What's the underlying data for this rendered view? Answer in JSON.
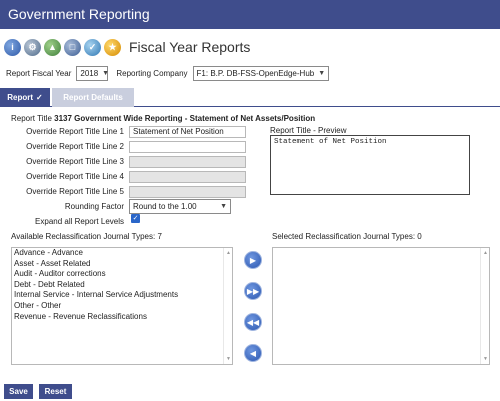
{
  "app": {
    "title": "Government Reporting"
  },
  "toolbar": {
    "icons": [
      "info-icon",
      "settings-gear-icon",
      "chart-icon",
      "documents-icon",
      "checklist-icon",
      "government-seal-icon"
    ],
    "page_title": "Fiscal Year Reports"
  },
  "filters": {
    "fiscal_year_label": "Report Fiscal Year",
    "fiscal_year_value": "2018",
    "company_label": "Reporting Company",
    "company_value": "F1: B.P. DB-FSS-OpenEdge-Hub"
  },
  "tabs": [
    {
      "label": "Report",
      "active": true
    },
    {
      "label": "Report Defaults",
      "active": false
    }
  ],
  "report": {
    "title_label": "Report Title",
    "title_value": "3137 Government Wide Reporting - Statement of Net Assets/Position",
    "override_lines": [
      {
        "label": "Override Report Title Line 1",
        "value": "Statement of Net Position",
        "enabled": true
      },
      {
        "label": "Override Report Title Line 2",
        "value": "",
        "enabled": true
      },
      {
        "label": "Override Report Title Line 3",
        "value": "",
        "enabled": false
      },
      {
        "label": "Override Report Title Line 4",
        "value": "",
        "enabled": false
      },
      {
        "label": "Override Report Title Line 5",
        "value": "",
        "enabled": false
      }
    ],
    "preview_label": "Report Title - Preview",
    "preview_text": "Statement of Net Position",
    "rounding_label": "Rounding Factor",
    "rounding_value": "Round to the 1.00",
    "expand_label": "Expand all Report Levels",
    "expand_checked": true
  },
  "reclass": {
    "available_label": "Available Reclassification Journal Types: 7",
    "selected_label": "Selected Reclassification Journal Types: 0",
    "available_items": [
      "Advance - Advance",
      "Asset - Asset Related",
      "Audit - Auditor corrections",
      "Debt - Debt Related",
      "Internal Service - Internal Service Adjustments",
      "Other - Other",
      "Revenue - Revenue Reclassifications"
    ],
    "selected_items": []
  },
  "buttons": {
    "save": "Save",
    "reset": "Reset"
  },
  "colors": {
    "brand": "#3f4d8c",
    "tab_inactive": "#c9cede",
    "move_button": "#2b57b0"
  }
}
